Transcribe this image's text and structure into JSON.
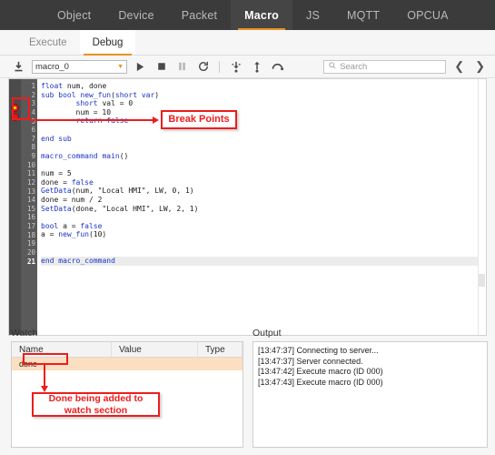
{
  "topnav": {
    "items": [
      {
        "label": "Object",
        "active": false
      },
      {
        "label": "Device",
        "active": false
      },
      {
        "label": "Packet",
        "active": false
      },
      {
        "label": "Macro",
        "active": true
      },
      {
        "label": "JS",
        "active": false
      },
      {
        "label": "MQTT",
        "active": false
      },
      {
        "label": "OPCUA",
        "active": false
      }
    ]
  },
  "subtabs": {
    "items": [
      {
        "label": "Execute",
        "active": false
      },
      {
        "label": "Debug",
        "active": true
      }
    ]
  },
  "toolbar": {
    "import_icon": "download-icon",
    "macro_name": "macro_0",
    "caret": "▼",
    "run_icon": "▶",
    "stop_icon": "■",
    "pause_icon": "❚❚",
    "restart_icon": "↻",
    "step_into_icon": "step-into-icon",
    "step_over_icon": "step-over-icon",
    "step_out_icon": "step-out-icon",
    "search_placeholder": "Search",
    "search_value": "",
    "search_icon": "search-icon",
    "prev_icon": "❮",
    "next_icon": "❯"
  },
  "editor": {
    "current_line": 21,
    "breakpoints": [
      4,
      5
    ],
    "lines": [
      {
        "n": 1,
        "text": "float num, done"
      },
      {
        "n": 2,
        "text": "sub bool new_fun(short var)"
      },
      {
        "n": 3,
        "text": "        short val = 0"
      },
      {
        "n": 4,
        "text": "        num = 10"
      },
      {
        "n": 5,
        "text": "        return false"
      },
      {
        "n": 6,
        "text": ""
      },
      {
        "n": 7,
        "text": "end sub"
      },
      {
        "n": 8,
        "text": ""
      },
      {
        "n": 9,
        "text": "macro_command main()"
      },
      {
        "n": 10,
        "text": ""
      },
      {
        "n": 11,
        "text": "num = 5"
      },
      {
        "n": 12,
        "text": "done = false"
      },
      {
        "n": 13,
        "text": "GetData(num, \"Local HMI\", LW, 0, 1)"
      },
      {
        "n": 14,
        "text": "done = num / 2"
      },
      {
        "n": 15,
        "text": "SetData(done, \"Local HMI\", LW, 2, 1)"
      },
      {
        "n": 16,
        "text": ""
      },
      {
        "n": 17,
        "text": "bool a = false"
      },
      {
        "n": 18,
        "text": "a = new_fun(10)"
      },
      {
        "n": 19,
        "text": ""
      },
      {
        "n": 20,
        "text": ""
      },
      {
        "n": 21,
        "text": "end macro_command"
      }
    ]
  },
  "annotations": {
    "breakpoints_label": "Break Points",
    "watch_label_line1": "Done being added to",
    "watch_label_line2": "watch section",
    "color": "#ee1c1c"
  },
  "watch": {
    "title": "Watch",
    "columns": [
      "Name",
      "Value",
      "Type"
    ],
    "rows": [
      {
        "name": "done",
        "value": "",
        "type": ""
      }
    ]
  },
  "output": {
    "title": "Output",
    "lines": [
      "[13:47:37] Connecting to server...",
      "[13:47:37] Server connected.",
      "[13:47:42] Execute macro (ID 000)",
      "[13:47:43] Execute macro (ID 000)"
    ]
  }
}
